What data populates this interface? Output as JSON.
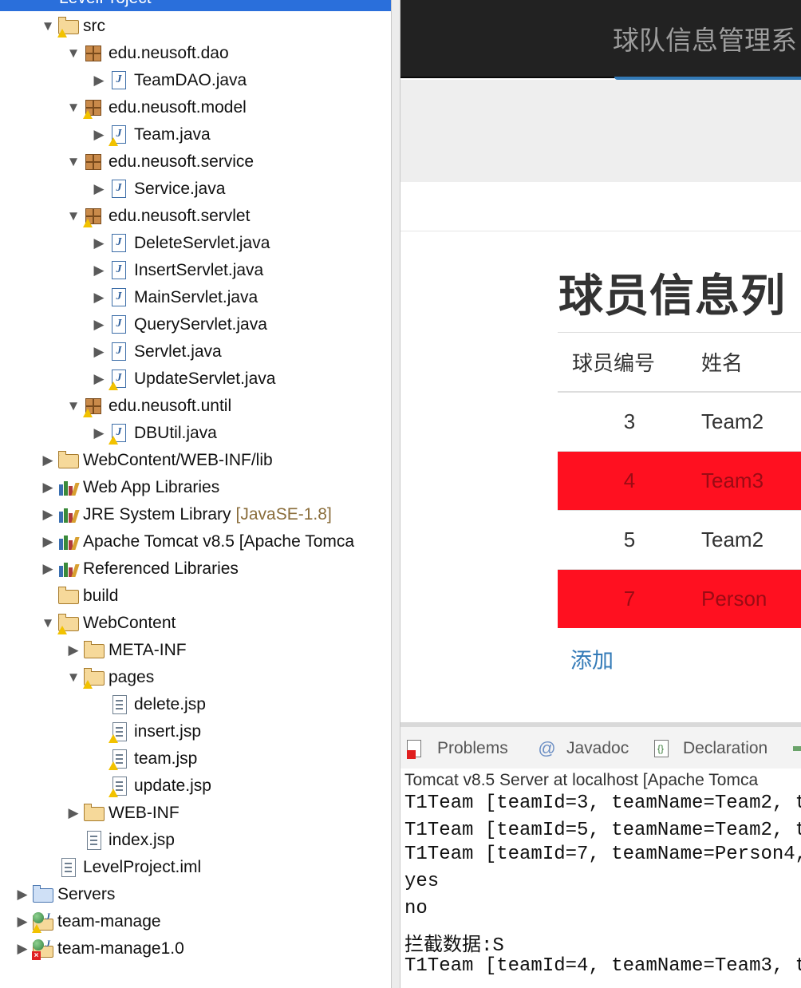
{
  "explorer": {
    "project_name": "LevelProject",
    "tree": [
      {
        "indent": 48,
        "expanded": true,
        "icon": "src-folder-warn",
        "label": "src"
      },
      {
        "indent": 80,
        "expanded": true,
        "icon": "package",
        "label": "edu.neusoft.dao"
      },
      {
        "indent": 112,
        "expanded": false,
        "icon": "java-file",
        "label": "TeamDAO.java"
      },
      {
        "indent": 80,
        "expanded": true,
        "icon": "package-warn",
        "label": "edu.neusoft.model"
      },
      {
        "indent": 112,
        "expanded": false,
        "icon": "java-file-warn",
        "label": "Team.java"
      },
      {
        "indent": 80,
        "expanded": true,
        "icon": "package",
        "label": "edu.neusoft.service"
      },
      {
        "indent": 112,
        "expanded": false,
        "icon": "java-file",
        "label": "Service.java"
      },
      {
        "indent": 80,
        "expanded": true,
        "icon": "package-warn",
        "label": "edu.neusoft.servlet"
      },
      {
        "indent": 112,
        "expanded": false,
        "icon": "java-file",
        "label": "DeleteServlet.java"
      },
      {
        "indent": 112,
        "expanded": false,
        "icon": "java-file",
        "label": "InsertServlet.java"
      },
      {
        "indent": 112,
        "expanded": false,
        "icon": "java-file",
        "label": "MainServlet.java"
      },
      {
        "indent": 112,
        "expanded": false,
        "icon": "java-file",
        "label": "QueryServlet.java"
      },
      {
        "indent": 112,
        "expanded": false,
        "icon": "java-file",
        "label": "Servlet.java"
      },
      {
        "indent": 112,
        "expanded": false,
        "icon": "java-file-warn",
        "label": "UpdateServlet.java"
      },
      {
        "indent": 80,
        "expanded": true,
        "icon": "package-warn",
        "label": "edu.neusoft.until"
      },
      {
        "indent": 112,
        "expanded": false,
        "icon": "java-file-warn",
        "label": "DBUtil.java"
      },
      {
        "indent": 48,
        "expanded": false,
        "icon": "folder-open",
        "label": "WebContent/WEB-INF/lib"
      },
      {
        "indent": 48,
        "expanded": false,
        "icon": "library",
        "label": "Web App Libraries"
      },
      {
        "indent": 48,
        "expanded": false,
        "icon": "library",
        "label": "JRE System Library",
        "decoration": "[JavaSE-1.8]"
      },
      {
        "indent": 48,
        "expanded": false,
        "icon": "library",
        "label": "Apache Tomcat v8.5 [Apache Tomca"
      },
      {
        "indent": 48,
        "expanded": false,
        "icon": "library",
        "label": "Referenced Libraries"
      },
      {
        "indent": 48,
        "expanded": null,
        "icon": "folder",
        "label": "build"
      },
      {
        "indent": 48,
        "expanded": true,
        "icon": "folder-warn",
        "label": "WebContent"
      },
      {
        "indent": 80,
        "expanded": false,
        "icon": "folder",
        "label": "META-INF"
      },
      {
        "indent": 80,
        "expanded": true,
        "icon": "folder-warn",
        "label": "pages"
      },
      {
        "indent": 112,
        "expanded": null,
        "icon": "jsp-file",
        "label": "delete.jsp"
      },
      {
        "indent": 112,
        "expanded": null,
        "icon": "jsp-file-warn",
        "label": "insert.jsp"
      },
      {
        "indent": 112,
        "expanded": null,
        "icon": "jsp-file-warn",
        "label": "team.jsp"
      },
      {
        "indent": 112,
        "expanded": null,
        "icon": "jsp-file-warn",
        "label": "update.jsp"
      },
      {
        "indent": 80,
        "expanded": false,
        "icon": "folder",
        "label": "WEB-INF"
      },
      {
        "indent": 80,
        "expanded": null,
        "icon": "jsp-file",
        "label": "index.jsp"
      },
      {
        "indent": 48,
        "expanded": null,
        "icon": "text-file",
        "label": "LevelProject.iml"
      },
      {
        "indent": 16,
        "expanded": false,
        "icon": "folder-blue",
        "label": "Servers"
      },
      {
        "indent": 16,
        "expanded": false,
        "icon": "web-project-warn",
        "label": "team-manage"
      },
      {
        "indent": 16,
        "expanded": false,
        "icon": "web-project-error",
        "label": "team-manage1.0"
      }
    ]
  },
  "browser": {
    "navbar_brand": "球队信息管理系",
    "heading": "球员信息列",
    "table": {
      "headers": [
        "球员编号",
        "姓名"
      ],
      "rows": [
        {
          "id": "3",
          "name": "Team2",
          "alert": false
        },
        {
          "id": "4",
          "name": "Team3",
          "alert": true
        },
        {
          "id": "5",
          "name": "Team2",
          "alert": false
        },
        {
          "id": "7",
          "name": "Person",
          "alert": true
        }
      ]
    },
    "add_link": "添加",
    "colors": {
      "navbar": "#222222",
      "jumbotron": "#eeeeee",
      "alert_row": "#ff1020",
      "link": "#337ab7"
    }
  },
  "console": {
    "tabs": [
      {
        "icon": "problems-icon",
        "label": "Problems"
      },
      {
        "icon": "javadoc-icon",
        "label": "Javadoc"
      },
      {
        "icon": "declaration-icon",
        "label": "Declaration"
      }
    ],
    "server_line": "Tomcat v8.5 Server at localhost [Apache Tomca",
    "lines": [
      "T1Team [teamId=3, teamName=Team2, t",
      "T1Team [teamId=5, teamName=Team2, t",
      "T1Team [teamId=7, teamName=Person4,",
      "yes",
      "no",
      "拦截数据:S",
      "T1Team [teamId=4, teamName=Team3, t"
    ]
  }
}
